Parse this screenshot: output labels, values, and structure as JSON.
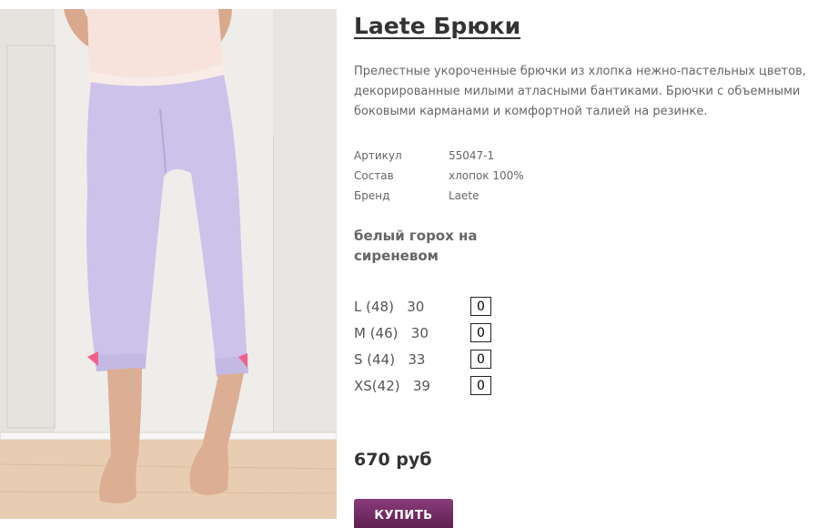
{
  "product": {
    "title": "Laete Брюки",
    "description": "Прелестные укороченные брючки из хлопка нежно-пастельных цветов, декорированные милыми атласными бантиками. Брючки с объемными боковыми карманами и комфортной талией на резинке.",
    "specs": [
      {
        "key": "Артикул",
        "value": "55047-1"
      },
      {
        "key": "Состав",
        "value": "хлопок 100%"
      },
      {
        "key": "Бренд",
        "value": "Laete"
      }
    ],
    "color_name": "белый горох на сиреневом",
    "sizes": [
      {
        "label": "L (48)   30",
        "qty": "0"
      },
      {
        "label": "M (46)   30",
        "qty": "0"
      },
      {
        "label": "S (44)   33",
        "qty": "0"
      },
      {
        "label": "XS(42)   39",
        "qty": "0"
      }
    ],
    "price": "670 руб",
    "buy_label": "КУПИТЬ",
    "colors": {
      "pants": "#cdc3ea",
      "button": "#6e2a62",
      "bow": "#f2618c"
    }
  }
}
